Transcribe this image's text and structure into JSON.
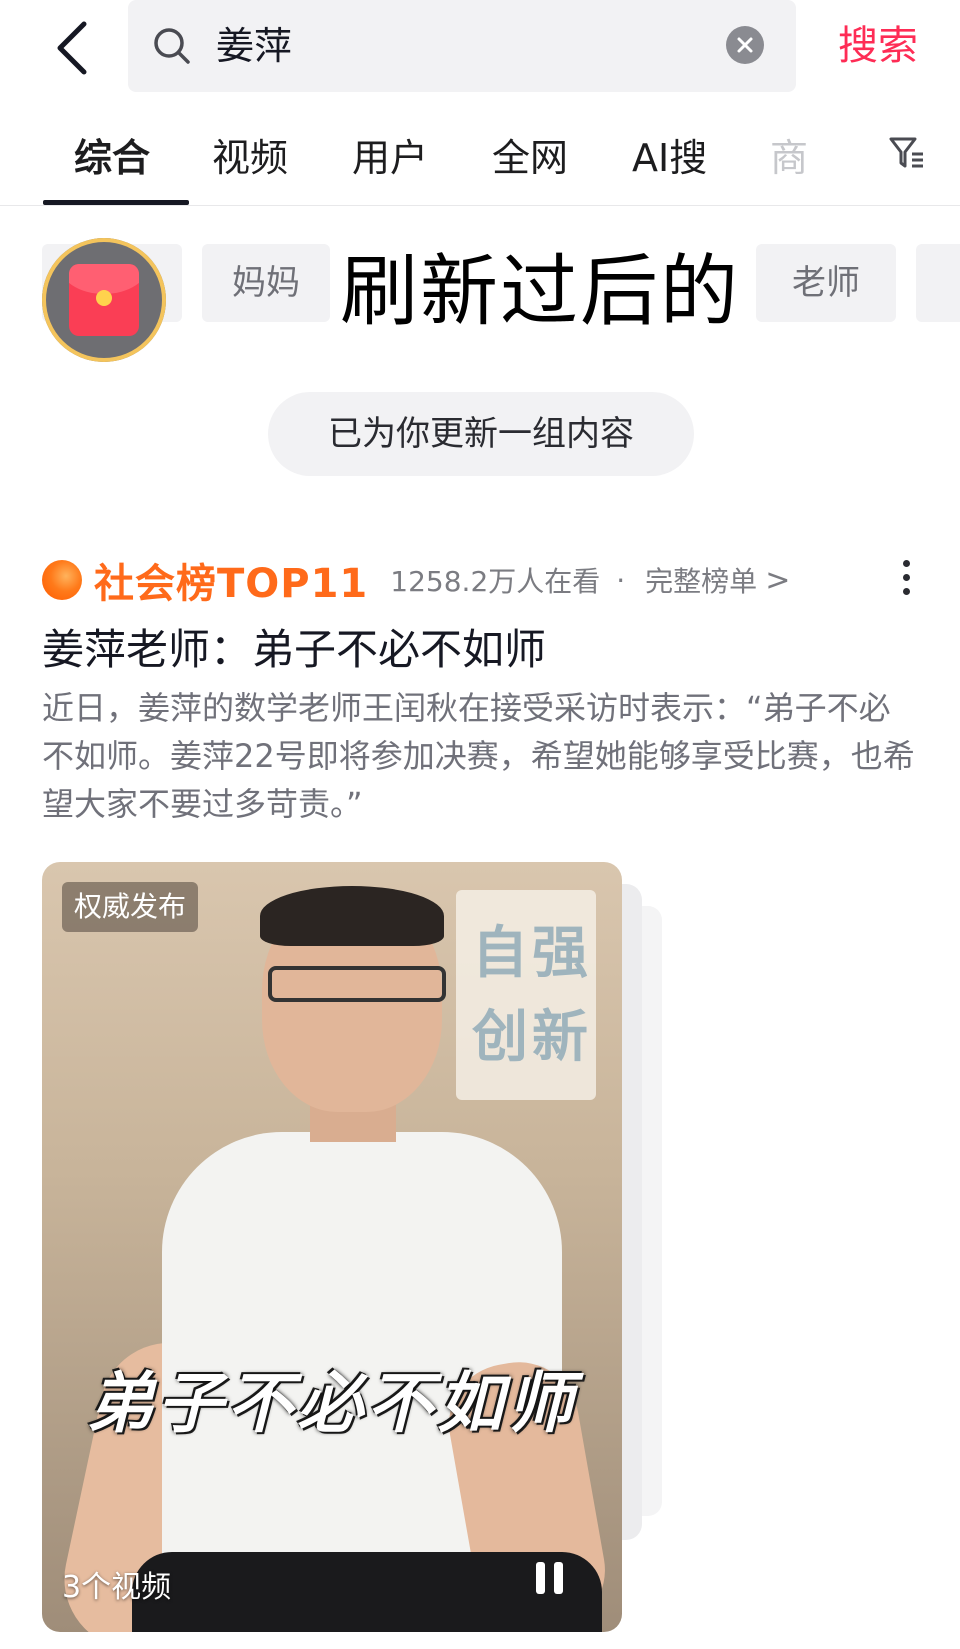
{
  "search": {
    "query": "姜萍",
    "submit_label": "搜索"
  },
  "tabs": [
    {
      "label": "综合",
      "active": true
    },
    {
      "label": "视频"
    },
    {
      "label": "用户"
    },
    {
      "label": "全网"
    },
    {
      "label": "AI搜"
    },
    {
      "label": "商"
    }
  ],
  "chips": [
    "妈妈",
    "老师"
  ],
  "overlay_text": "刷新过后的",
  "refresh_notice": "已为你更新一组内容",
  "hot_list": {
    "title": "社会榜TOP11",
    "viewers": "1258.2万人在看",
    "separator": "·",
    "full_list_label": "完整榜单",
    "chevron": ">"
  },
  "article": {
    "title": "姜萍老师：弟子不必不如师",
    "description": "近日，姜萍的数学老师王闰秋在接受采访时表示：“弟子不必不如师。姜萍22号即将参加决赛，希望她能够享受比赛，也希望大家不要过多苛责。”"
  },
  "video": {
    "badge": "权威发布",
    "caption": "弟子不必不如师",
    "count_label": "3个视频",
    "wall_sign": "自强 创新"
  },
  "colors": {
    "accent": "#fe2c55",
    "hot_orange": "#ff6a1a",
    "chip_bg": "#f2f2f4"
  },
  "icons": [
    "back-icon",
    "search-icon",
    "clear-icon",
    "filter-icon",
    "red-packet-icon",
    "more-icon",
    "pause-icon"
  ]
}
